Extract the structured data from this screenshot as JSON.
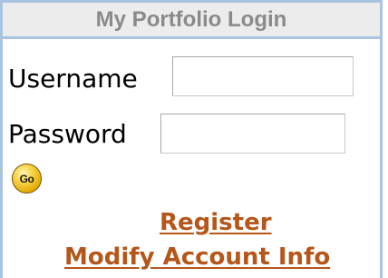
{
  "login": {
    "title": "My Portfolio Login",
    "username_label": "Username",
    "username_value": "",
    "password_label": "Password",
    "password_value": "",
    "go_label": "Go",
    "register_link": "Register",
    "modify_link": "Modify Account Info"
  },
  "colors": {
    "border": "#a8c4e0",
    "title_bg": "#ececec",
    "title_text": "#8a8a8a",
    "link": "#b5561a",
    "go_button": "#f7d44a"
  },
  "icons": {
    "go_button": "go-icon"
  }
}
